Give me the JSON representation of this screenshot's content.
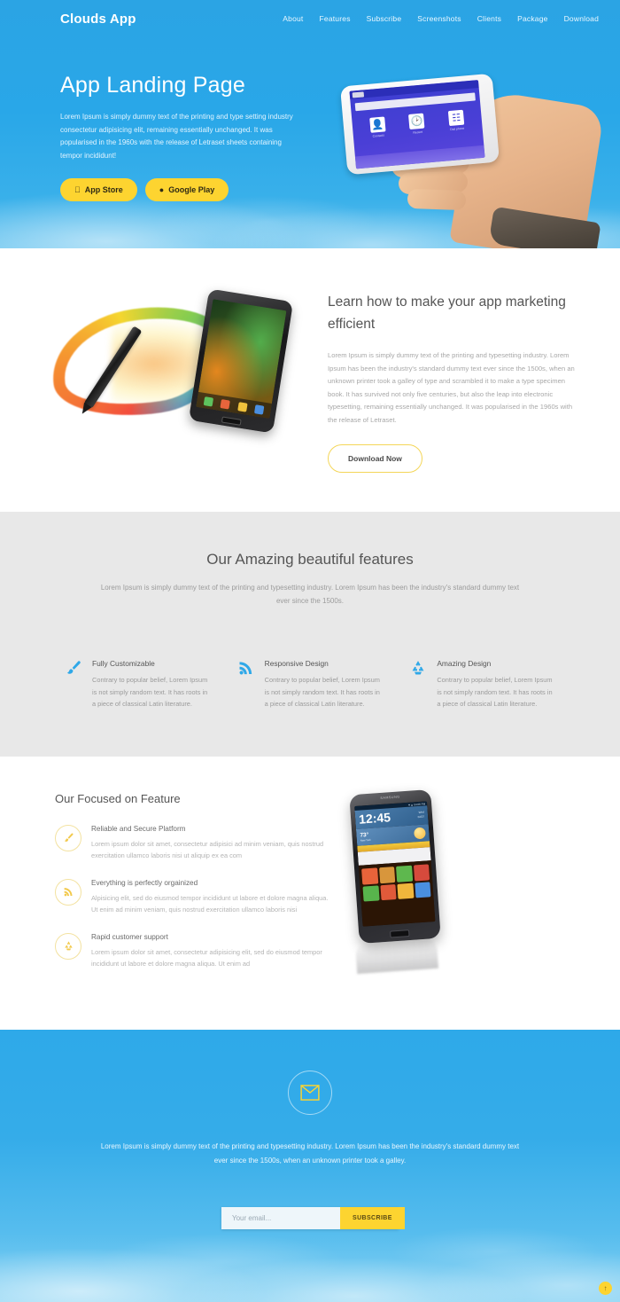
{
  "theme": {
    "sky_blue": "#29a7e8",
    "accent_yellow": "#fdd430",
    "features_bg": "#e8e8e8",
    "heading_gray": "#555555",
    "body_gray": "#a8a8a8"
  },
  "nav": {
    "brand": "Clouds App",
    "links": [
      {
        "label": "About"
      },
      {
        "label": "Features"
      },
      {
        "label": "Subscribe"
      },
      {
        "label": "Screenshots"
      },
      {
        "label": "Clients"
      },
      {
        "label": "Package"
      },
      {
        "label": "Download"
      }
    ]
  },
  "hero": {
    "title": "App Landing Page",
    "body": "Lorem Ipsum is simply dummy text of the printing and type setting industry consectetur adipisicing elit, remaining essentially unchanged. It was popularised in the 1960s with the release of Letraset sheets containing tempor incididunt!",
    "app_store_label": "App Store",
    "app_store_icon": "apple-icon",
    "google_play_label": "Google Play",
    "google_play_icon": "android-icon",
    "phone_screen": {
      "tabs": [
        "Contacts",
        "Recent",
        "Dial phone"
      ]
    }
  },
  "learn": {
    "title": "Learn how to make your app marketing efficient",
    "body": "Lorem Ipsum is simply dummy text of the printing and typesetting industry. Lorem Ipsum has been the industry's standard dummy text ever since the 1500s, when an unknown printer took a galley of type and scrambled it to make a type specimen book. It has survived not only five centuries, but also the leap into electronic typesetting, remaining essentially unchanged. It was popularised in the 1960s with the release of Letraset.",
    "cta_label": "Download Now"
  },
  "features": {
    "title": "Our Amazing beautiful features",
    "subtitle": "Lorem Ipsum is simply dummy text of the printing and typesetting industry. Lorem Ipsum has been the industry's standard dummy text ever since the 1500s.",
    "items": [
      {
        "icon": "paintbrush-icon",
        "title": "Fully Customizable",
        "body": "Contrary to popular belief, Lorem Ipsum is not simply random text. It has roots in a piece of classical Latin literature."
      },
      {
        "icon": "rss-signal-icon",
        "title": "Responsive Design",
        "body": "Contrary to popular belief, Lorem Ipsum is not simply random text. It has roots in a piece of classical Latin literature."
      },
      {
        "icon": "recycle-icon",
        "title": "Amazing Design",
        "body": "Contrary to popular belief, Lorem Ipsum is not simply random text. It has roots in a piece of classical Latin literature."
      }
    ]
  },
  "focused": {
    "title": "Our Focused on Feature",
    "items": [
      {
        "icon": "paintbrush-icon",
        "title": "Reliable and Secure Platform",
        "body": "Lorem ipsum dolor sit amet, consectetur adipisici ad minim veniam, quis nostrud exercitation ullamco laboris nisi ut aliquip ex ea com"
      },
      {
        "icon": "rss-signal-icon",
        "title": "Everything is perfectly orgainized",
        "body": "Alpisicing elit, sed do eiusmod tempor incididunt ut labore et dolore magna aliqua. Ut enim ad minim veniam, quis nostrud exercitation ullamco laboris nisi"
      },
      {
        "icon": "recycle-icon",
        "title": "Rapid customer support",
        "body": "Lorem ipsum dolor sit amet, consectetur adipisicing elit, sed do eiusmod tempor incididunt ut labore et dolore magna aliqua. Ut enim ad"
      }
    ],
    "phone": {
      "brand": "SAMSUNG",
      "time": "12:45",
      "date_line1": "Wed",
      "date_line2": "04/27",
      "temp": "73°",
      "location": "New York"
    }
  },
  "subscribe": {
    "icon": "envelope-icon",
    "text": "Lorem Ipsum is simply dummy text of the printing and typesetting industry. Lorem Ipsum has been the industry's standard dummy text ever since the 1500s, when an unknown printer took a galley.",
    "input_placeholder": "Your email...",
    "input_value": "",
    "button_label": "SUBSCRIBE"
  },
  "corner": {
    "badge_icon": "scroll-top-icon",
    "badge_glyph": "↑"
  }
}
